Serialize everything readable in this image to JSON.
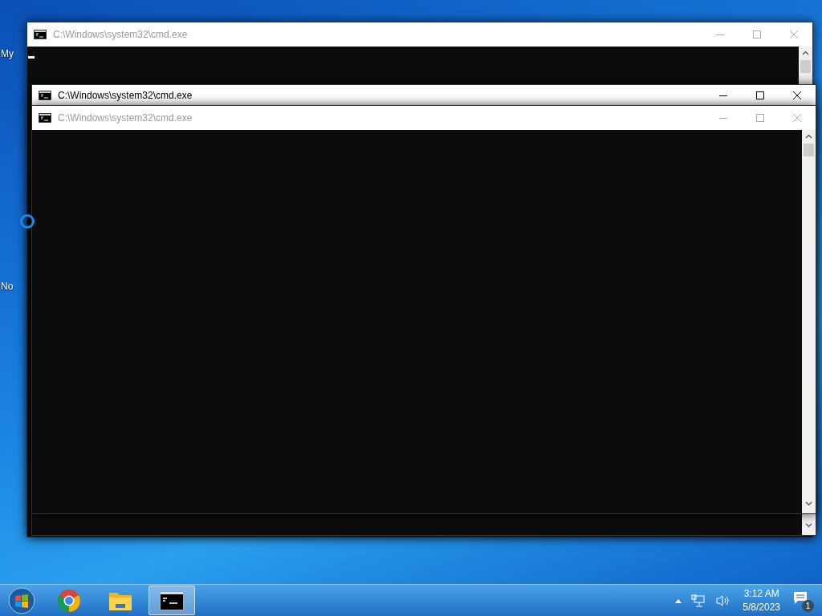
{
  "desktop_icons": [
    {
      "label": "My"
    },
    {
      "label": "No"
    }
  ],
  "windows": [
    {
      "title": "C:\\Windows\\system32\\cmd.exe",
      "active": false,
      "cursor": true
    },
    {
      "title": "C:\\Windows\\system32\\cmd.exe",
      "active": true,
      "cursor": false
    },
    {
      "title": "C:\\Windows\\system32\\cmd.exe",
      "active": false,
      "cursor": false
    }
  ],
  "taskbar": {
    "items": [
      {
        "kind": "browser",
        "selected": false
      },
      {
        "kind": "folder",
        "selected": false
      },
      {
        "kind": "console",
        "selected": true
      }
    ],
    "tray": {
      "time": "3:12 AM",
      "date": "5/8/2023",
      "notification_count": "1"
    }
  }
}
